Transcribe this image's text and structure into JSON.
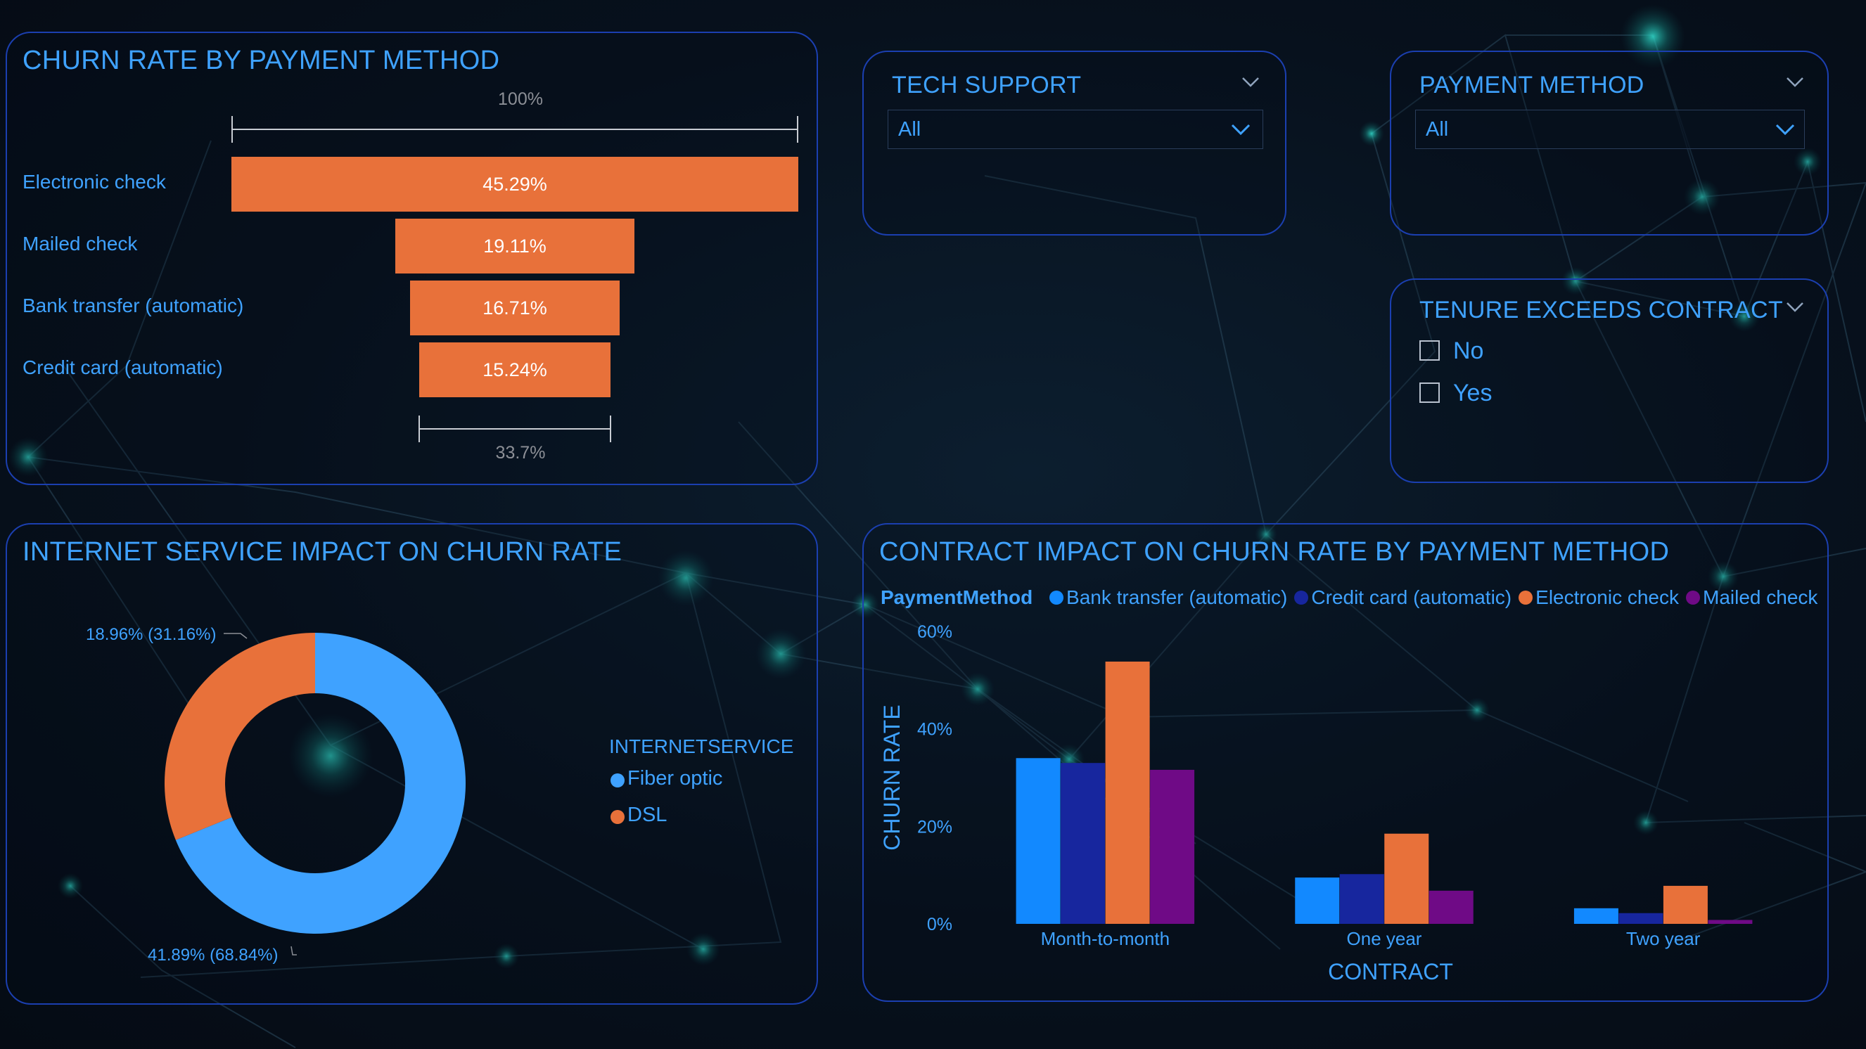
{
  "colors": {
    "accent": "#3fa2ff",
    "border": "#1b3fb0",
    "funnel_bar": "#e8713a",
    "fiber": "#3fa2ff",
    "dsl": "#e8713a",
    "bank_transfer": "#1289ff",
    "credit_card": "#17269e",
    "electronic_check": "#e8713a",
    "mailed_check": "#6f0a86"
  },
  "funnel": {
    "title": "CHURN RATE BY PAYMENT METHOD",
    "top_label": "100%",
    "bottom_label": "33.7%",
    "items": [
      {
        "label": "Electronic check",
        "value": 45.29,
        "value_label": "45.29%"
      },
      {
        "label": "Mailed check",
        "value": 19.11,
        "value_label": "19.11%"
      },
      {
        "label": "Bank transfer (automatic)",
        "value": 16.71,
        "value_label": "16.71%"
      },
      {
        "label": "Credit card (automatic)",
        "value": 15.24,
        "value_label": "15.24%"
      }
    ]
  },
  "slicers": {
    "tech_support": {
      "title": "TECH SUPPORT",
      "value": "All"
    },
    "payment_method": {
      "title": "PAYMENT METHOD",
      "value": "All"
    },
    "tenure": {
      "title": "TENURE EXCEEDS CONTRACT",
      "options": [
        "No",
        "Yes"
      ]
    }
  },
  "donut": {
    "title": "INTERNET SERVICE IMPACT ON CHURN RATE",
    "legend_title": "INTERNETSERVICE",
    "slices": [
      {
        "name": "Fiber optic",
        "value": 68.84,
        "label": "41.89% (68.84%)"
      },
      {
        "name": "DSL",
        "value": 31.16,
        "label": "18.96% (31.16%)"
      }
    ]
  },
  "contract": {
    "title": "CONTRACT IMPACT ON CHURN RATE BY PAYMENT METHOD",
    "legend_title": "PaymentMethod"
  },
  "chart_data": {
    "type": "bar",
    "title": "CONTRACT IMPACT ON CHURN RATE BY PAYMENT METHOD",
    "xlabel": "CONTRACT",
    "ylabel": "CHURN RATE",
    "categories": [
      "Month-to-month",
      "One year",
      "Two year"
    ],
    "yticks": [
      "0%",
      "20%",
      "40%",
      "60%"
    ],
    "ylim": [
      0,
      60
    ],
    "grid": false,
    "legend": "top",
    "series": [
      {
        "name": "Bank transfer (automatic)",
        "values": [
          34,
          9.5,
          3.2
        ]
      },
      {
        "name": "Credit card (automatic)",
        "values": [
          33,
          10.2,
          2.2
        ]
      },
      {
        "name": "Electronic check",
        "values": [
          53.8,
          18.5,
          7.8
        ]
      },
      {
        "name": "Mailed check",
        "values": [
          31.6,
          6.8,
          0.8
        ]
      }
    ]
  }
}
